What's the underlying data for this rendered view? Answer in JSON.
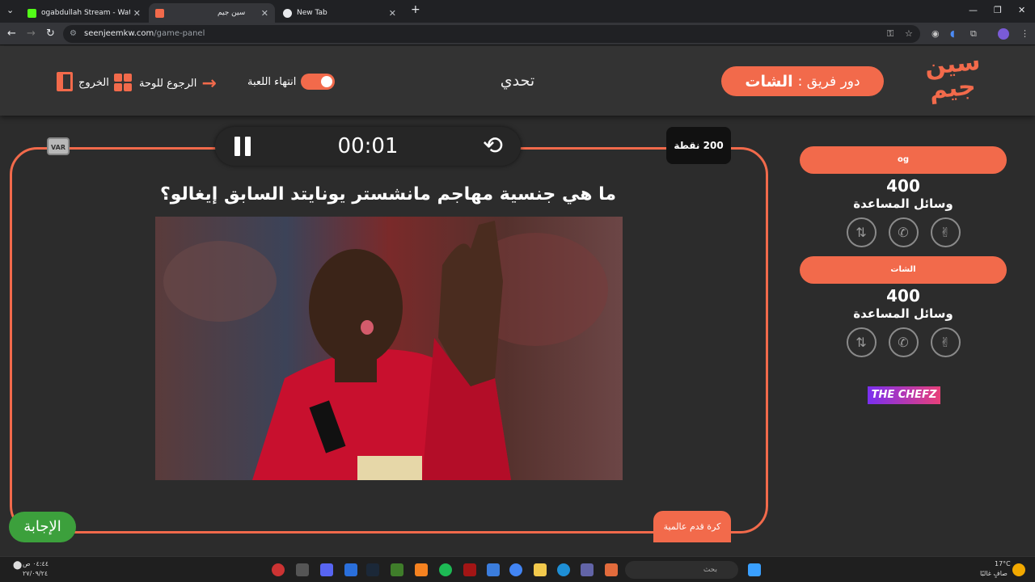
{
  "browser": {
    "tabs": [
      {
        "label": "ogabdullah Stream - Watch Live",
        "active": false
      },
      {
        "label": "سين جيم",
        "active": true
      },
      {
        "label": "New Tab",
        "active": false
      }
    ],
    "url_domain": "seenjeemkw.com",
    "url_path": "/game-panel"
  },
  "header": {
    "logo_line1": "سين",
    "logo_line2": "جيم",
    "turn_prefix": "دور فريق :",
    "turn_team": "الشات",
    "game_title": "تحدي",
    "end_game_label": "انتهاء اللعبة",
    "back_to_board_label": "الرجوع للوحة",
    "exit_label": "الخروج"
  },
  "question_panel": {
    "time": "00:01",
    "points_label": "200 نقطة",
    "var_label": "VAR",
    "question": "ما هي جنسية مهاجم مانشستر يونايتد السابق إيغالو؟",
    "answer_button": "الإجابة",
    "category": "كرة قدم عالمية"
  },
  "teams": [
    {
      "name": "og",
      "score": "400",
      "helps_label": "وسائل المساعدة"
    },
    {
      "name": "الشات",
      "score": "400",
      "helps_label": "وسائل المساعدة"
    }
  ],
  "sponsor": "THE CHEFZ",
  "taskbar": {
    "search_placeholder": "بحث",
    "time": "٠٤:٤٤ ص",
    "date": "٢٧/٠٩/٢٤",
    "weather_temp": "17°C",
    "weather_desc": "صافٍ غالبًا"
  },
  "colors": {
    "accent": "#f26a4b",
    "answer": "#3ca03c",
    "background": "#2c2c2c"
  }
}
